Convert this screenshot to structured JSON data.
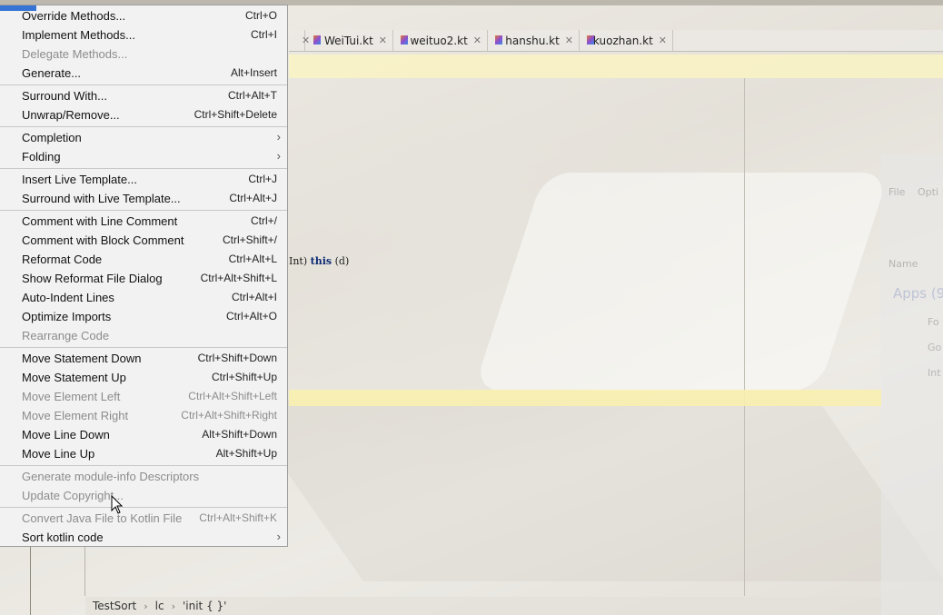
{
  "tabs": [
    {
      "label": "WeiTui.kt"
    },
    {
      "label": "weituo2.kt"
    },
    {
      "label": "hanshu.kt"
    },
    {
      "label": "kuozhan.kt"
    }
  ],
  "code_fragment": {
    "text_a": "Int)",
    "kw": "this",
    "text_b": "(d)"
  },
  "menu": {
    "items": [
      {
        "label": "Override Methods...",
        "shortcut": "Ctrl+O"
      },
      {
        "label": "Implement Methods...",
        "shortcut": "Ctrl+I"
      },
      {
        "label": "Delegate Methods...",
        "shortcut": ""
      },
      {
        "label": "Generate...",
        "shortcut": "Alt+Insert"
      },
      {
        "label": "Surround With...",
        "shortcut": "Ctrl+Alt+T"
      },
      {
        "label": "Unwrap/Remove...",
        "shortcut": "Ctrl+Shift+Delete"
      },
      {
        "label": "Completion",
        "shortcut": ""
      },
      {
        "label": "Folding",
        "shortcut": ""
      },
      {
        "label": "Insert Live Template...",
        "shortcut": "Ctrl+J"
      },
      {
        "label": "Surround with Live Template...",
        "shortcut": "Ctrl+Alt+J"
      },
      {
        "label": "Comment with Line Comment",
        "shortcut": "Ctrl+/"
      },
      {
        "label": "Comment with Block Comment",
        "shortcut": "Ctrl+Shift+/"
      },
      {
        "label": "Reformat Code",
        "shortcut": "Ctrl+Alt+L"
      },
      {
        "label": "Show Reformat File Dialog",
        "shortcut": "Ctrl+Alt+Shift+L"
      },
      {
        "label": "Auto-Indent Lines",
        "shortcut": "Ctrl+Alt+I"
      },
      {
        "label": "Optimize Imports",
        "shortcut": "Ctrl+Alt+O"
      },
      {
        "label": "Rearrange Code",
        "shortcut": ""
      },
      {
        "label": "Move Statement Down",
        "shortcut": "Ctrl+Shift+Down"
      },
      {
        "label": "Move Statement Up",
        "shortcut": "Ctrl+Shift+Up"
      },
      {
        "label": "Move Element Left",
        "shortcut": "Ctrl+Alt+Shift+Left"
      },
      {
        "label": "Move Element Right",
        "shortcut": "Ctrl+Alt+Shift+Right"
      },
      {
        "label": "Move Line Down",
        "shortcut": "Alt+Shift+Down"
      },
      {
        "label": "Move Line Up",
        "shortcut": "Alt+Shift+Up"
      },
      {
        "label": "Generate module-info Descriptors",
        "shortcut": ""
      },
      {
        "label": "Update Copyright...",
        "shortcut": ""
      },
      {
        "label": "Convert Java File to Kotlin File",
        "shortcut": "Ctrl+Alt+Shift+K"
      },
      {
        "label": "Sort kotlin code",
        "shortcut": ""
      }
    ]
  },
  "breadcrumb": {
    "items": [
      "TestSort",
      "lc",
      "'init { }'"
    ]
  },
  "ghost_panel": {
    "labels": [
      "File",
      "Opti",
      "Name",
      "Apps (9",
      "Fo",
      "Go",
      "Int"
    ]
  },
  "colors": {
    "menu_bg": "#f2f2f2",
    "accent": "#3574d4",
    "disabled_text": "#8c8c8c",
    "highlight_line": "#f8f0af"
  }
}
